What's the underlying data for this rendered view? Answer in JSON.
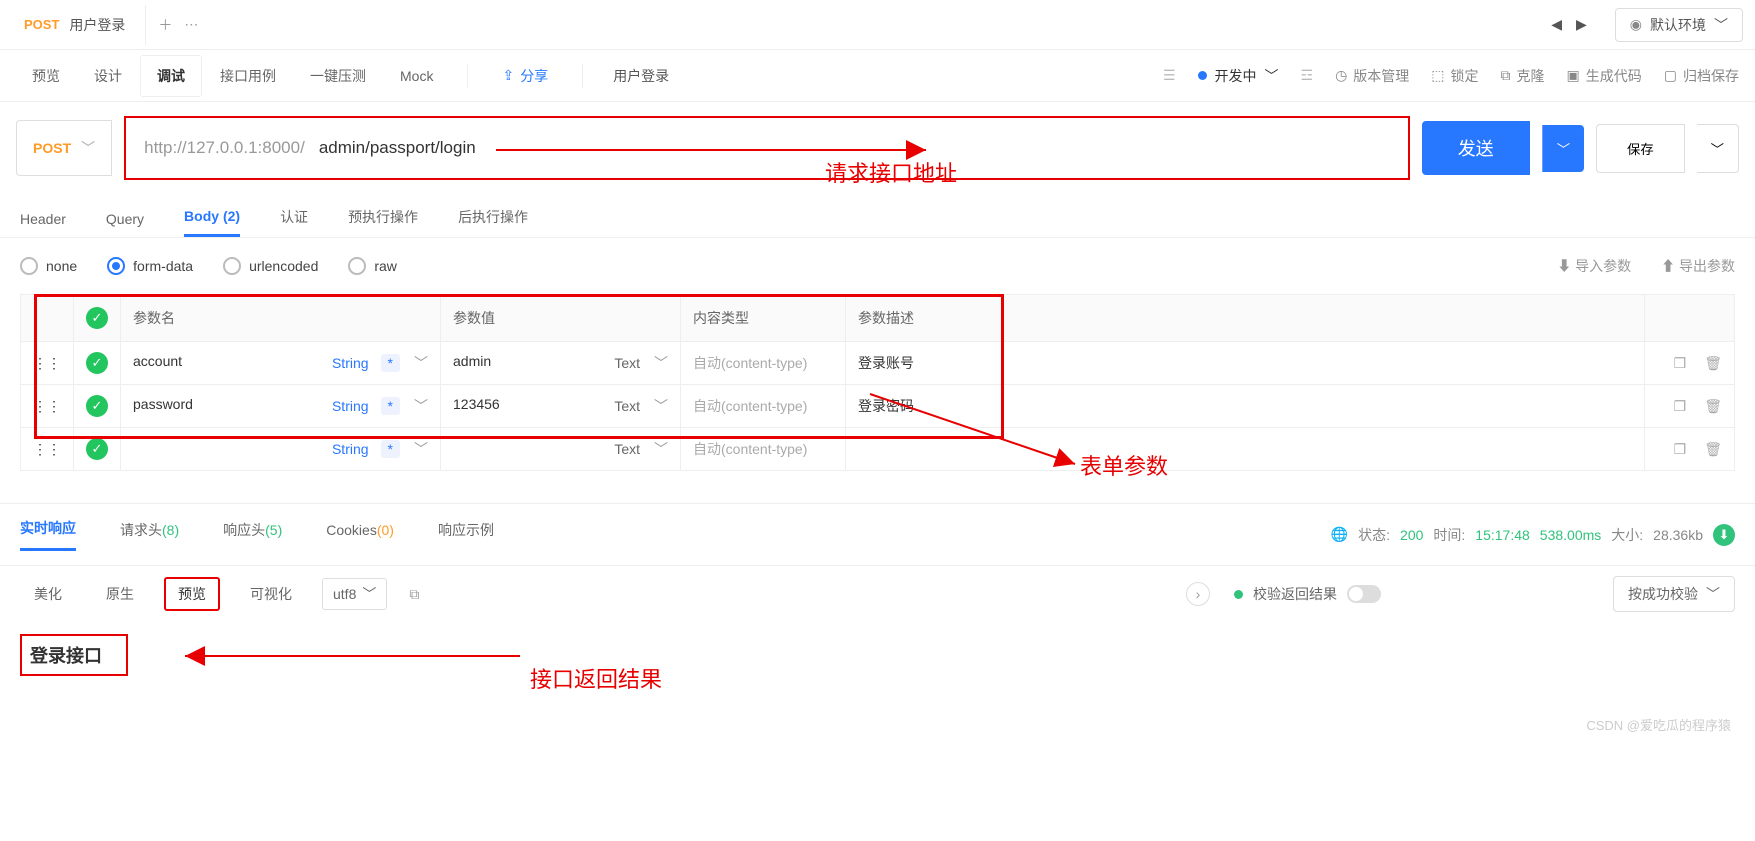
{
  "topbar": {
    "tab_method": "POST",
    "tab_title": "用户登录",
    "env_label": "默认环境"
  },
  "subtabs": {
    "preview": "预览",
    "design": "设计",
    "debug": "调试",
    "cases": "接口用例",
    "perf": "一键压测",
    "mock": "Mock",
    "share": "分享",
    "api_name": "用户登录",
    "status": "开发中",
    "version": "版本管理",
    "lock": "锁定",
    "clone": "克隆",
    "codegen": "生成代码",
    "archive": "归档保存"
  },
  "addr": {
    "method": "POST",
    "prefix": "http://127.0.0.1:8000/",
    "path": "admin/passport/login",
    "btn_send": "发送",
    "btn_save": "保存"
  },
  "reqtabs": {
    "header": "Header",
    "query": "Query",
    "body": "Body",
    "body_count": "(2)",
    "auth": "认证",
    "pre": "预执行操作",
    "post": "后执行操作"
  },
  "bodytypes": {
    "none": "none",
    "formdata": "form-data",
    "urlenc": "urlencoded",
    "raw": "raw",
    "import": "导入参数",
    "export": "导出参数"
  },
  "table": {
    "headers": {
      "name": "参数名",
      "value": "参数值",
      "ctype": "内容类型",
      "desc": "参数描述"
    },
    "type_label": "String",
    "text_label": "Text",
    "ctype_placeholder": "自动(content-type)",
    "rows": [
      {
        "name": "account",
        "value": "admin",
        "desc": "登录账号"
      },
      {
        "name": "password",
        "value": "123456",
        "desc": "登录密码"
      },
      {
        "name": "",
        "value": "",
        "desc": ""
      }
    ]
  },
  "annot": {
    "addr": "请求接口地址",
    "form": "表单参数",
    "resp": "接口返回结果"
  },
  "resp": {
    "tabs": {
      "live": "实时响应",
      "reqh": "请求头",
      "reqh_count": "(8)",
      "resph": "响应头",
      "resph_count": "(5)",
      "cookies": "Cookies",
      "cookies_count": "(0)",
      "example": "响应示例"
    },
    "status_label": "状态:",
    "status_code": "200",
    "time_label": "时间:",
    "time_at": "15:17:48",
    "time_dur": "538.00ms",
    "size_label": "大小:",
    "size_val": "28.36kb",
    "view": {
      "beautify": "美化",
      "raw": "原生",
      "preview": "预览",
      "visual": "可视化",
      "enc": "utf8"
    },
    "verify_label": "校验返回结果",
    "validate_btn": "按成功校验",
    "body_title": "登录接口"
  },
  "watermark": "CSDN @爱吃瓜的程序猿"
}
